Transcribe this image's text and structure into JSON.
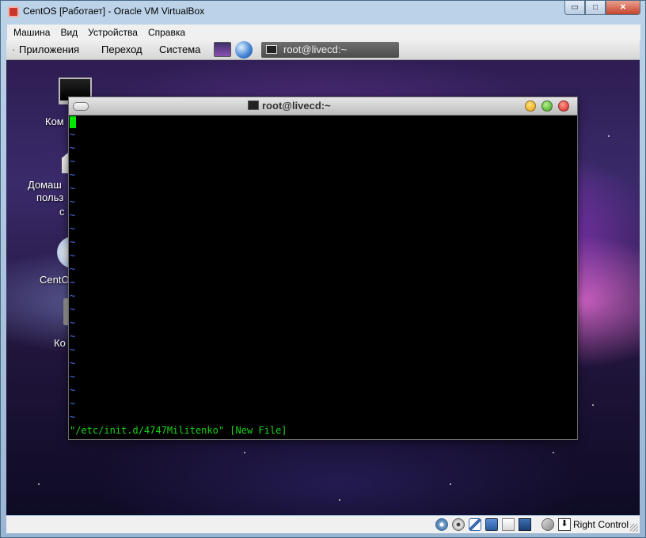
{
  "window": {
    "title": "CentOS [Работает] - Oracle VM VirtualBox",
    "min_glyph": "▭",
    "max_glyph": "□",
    "close_glyph": "✕"
  },
  "vbox_menu": [
    "Машина",
    "Вид",
    "Устройства",
    "Справка"
  ],
  "gnome_panel": {
    "items": [
      "Приложения",
      "Переход",
      "Система"
    ],
    "task_button": "root@livecd:~"
  },
  "desktop_icons": [
    {
      "label": "Ком",
      "icon": "computer-icon"
    },
    {
      "label_lines": [
        "Домаш",
        "польз",
        "с"
      ],
      "icon": "home-folder-icon"
    },
    {
      "label": "CentO",
      "icon": "cd-icon"
    },
    {
      "label": "Ко",
      "icon": "trash-icon"
    }
  ],
  "terminal": {
    "title": "root@livecd:~",
    "tilde_char": "~",
    "tilde_count": 22,
    "status_line": "\"/etc/init.d/4747Militenko\" [New File]",
    "cursor_color": "#00e800",
    "tilde_color": "#4a6ef2",
    "status_color": "#19d419"
  },
  "statusbar": {
    "host_key": "Right Control",
    "arrow_glyph": "⬇",
    "icons": [
      "hdd-icon",
      "cd-icon",
      "usb-icon",
      "network-icon",
      "shared-folder-icon",
      "display-icon",
      "mouse-integration-icon",
      "keyboard-capture-icon"
    ]
  }
}
